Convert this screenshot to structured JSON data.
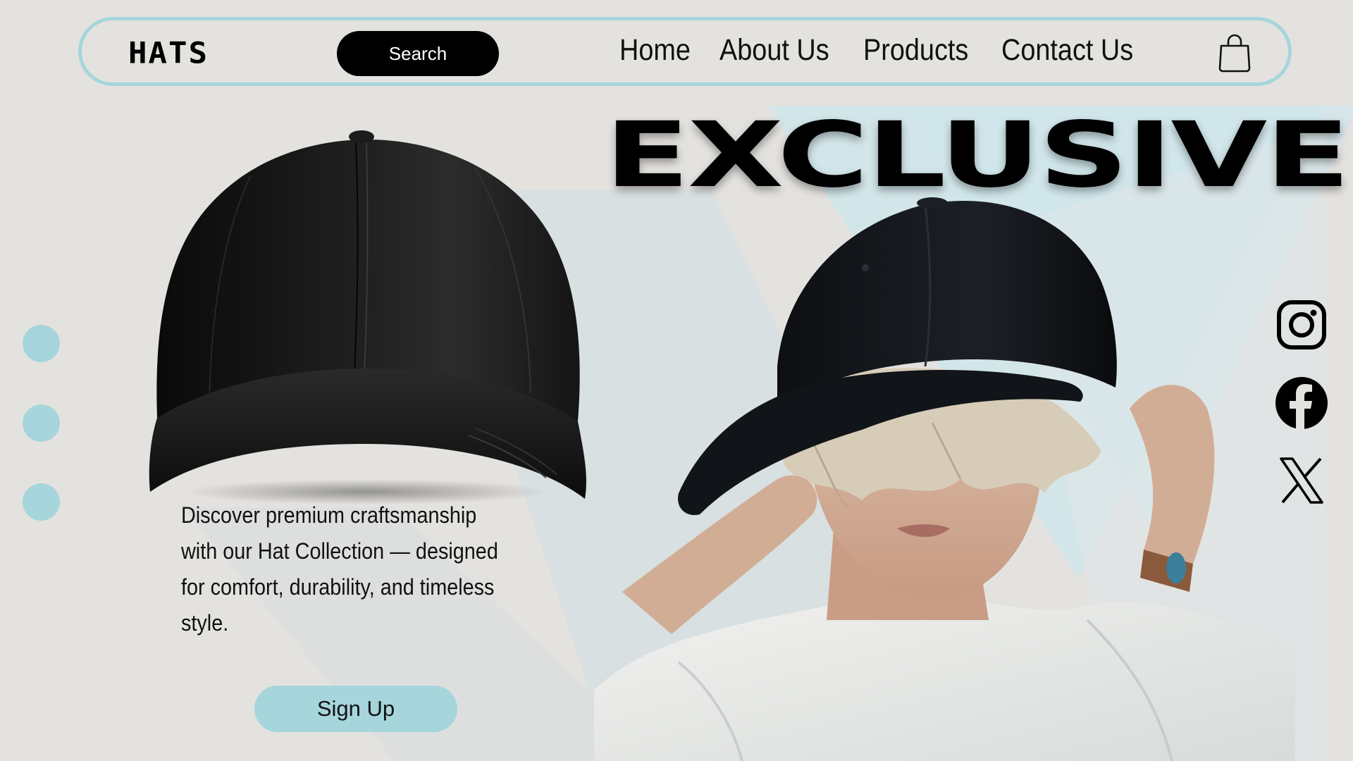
{
  "brand": {
    "logo": "HATS",
    "accent_color": "#a6d5dc",
    "text_color": "#000000"
  },
  "nav": {
    "search_label": "Search",
    "links": [
      "Home",
      "About Us",
      "Products",
      "Contact Us"
    ],
    "cart_icon": "shopping-bag-icon"
  },
  "hero": {
    "headline": "EXCLUSIVE",
    "description": "Discover premium craftsmanship with our Hat Collection — designed for comfort, durability, and timeless style.",
    "signup_label": "Sign Up",
    "product_image": "black-baseball-cap",
    "model_image": "person-wearing-black-cap"
  },
  "slider": {
    "dots": 3
  },
  "social": {
    "icons": [
      "instagram-icon",
      "facebook-icon",
      "x-icon"
    ]
  }
}
